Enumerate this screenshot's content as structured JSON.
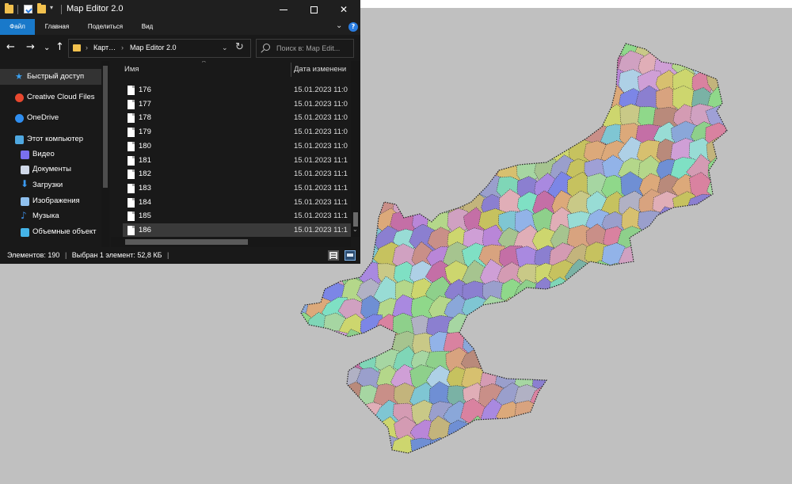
{
  "window": {
    "title": "Map Editor 2.0",
    "minimize_glyph": "—",
    "maximize_glyph": "☐",
    "close_glyph": "✕"
  },
  "ribbon": {
    "tabs": [
      {
        "label": "Файл",
        "active": true
      },
      {
        "label": "Главная",
        "active": false
      },
      {
        "label": "Поделиться",
        "active": false
      },
      {
        "label": "Вид",
        "active": false
      }
    ],
    "collapse_glyph": "⌄",
    "help_glyph": "?"
  },
  "navigation": {
    "back_glyph": "←",
    "forward_glyph": "→",
    "history_glyph": "⌄",
    "up_glyph": "↑",
    "refresh_glyph": "↻"
  },
  "address": {
    "crumbs": [
      {
        "text": "›"
      },
      {
        "text": "Карт…"
      },
      {
        "text": "›"
      },
      {
        "text": "Map Editor 2.0"
      }
    ],
    "dropdown_glyph": "⌄"
  },
  "search": {
    "placeholder": "Поиск в: Map Edit..."
  },
  "nav_pane": {
    "items": [
      {
        "label": "Быстрый доступ",
        "icon": "star-icon",
        "selected": true
      },
      {
        "label": "Creative Cloud Files",
        "icon": "creative-cloud-icon",
        "selected": false
      },
      {
        "label": "OneDrive",
        "icon": "cloud-icon",
        "selected": false
      },
      {
        "label": "Этот компьютер",
        "icon": "computer-icon",
        "selected": false
      },
      {
        "label": "Видео",
        "icon": "video-icon",
        "selected": false
      },
      {
        "label": "Документы",
        "icon": "document-icon",
        "selected": false
      },
      {
        "label": "Загрузки",
        "icon": "download-icon",
        "selected": false
      },
      {
        "label": "Изображения",
        "icon": "image-icon",
        "selected": false
      },
      {
        "label": "Музыка",
        "icon": "music-icon",
        "selected": false
      },
      {
        "label": "Объемные объект",
        "icon": "3d-objects-icon",
        "selected": false
      }
    ]
  },
  "file_list": {
    "columns": {
      "name": "Имя",
      "date": "Дата изменени"
    },
    "rows": [
      {
        "name": "176",
        "date": "15.01.2023 11:0",
        "selected": false
      },
      {
        "name": "177",
        "date": "15.01.2023 11:0",
        "selected": false
      },
      {
        "name": "178",
        "date": "15.01.2023 11:0",
        "selected": false
      },
      {
        "name": "179",
        "date": "15.01.2023 11:0",
        "selected": false
      },
      {
        "name": "180",
        "date": "15.01.2023 11:0",
        "selected": false
      },
      {
        "name": "181",
        "date": "15.01.2023 11:1",
        "selected": false
      },
      {
        "name": "182",
        "date": "15.01.2023 11:1",
        "selected": false
      },
      {
        "name": "183",
        "date": "15.01.2023 11:1",
        "selected": false
      },
      {
        "name": "184",
        "date": "15.01.2023 11:1",
        "selected": false
      },
      {
        "name": "185",
        "date": "15.01.2023 11:1",
        "selected": false
      },
      {
        "name": "186",
        "date": "15.01.2023 11:1",
        "selected": true
      }
    ]
  },
  "status_bar": {
    "item_count": "Элементов: 190",
    "separator": "|",
    "selection": "Выбран 1 элемент: 52,8 КБ",
    "trailing": "|"
  },
  "colors": {
    "canvas_bg": "#c0c0c0",
    "window_bg": "#191919",
    "accent": "#1979ca",
    "region_border": "#222222"
  },
  "map": {
    "region_colors": [
      "#c3b47c",
      "#d49bb3",
      "#7c86e6",
      "#8fd88a",
      "#b986d8",
      "#7fc6d3",
      "#d7c06f",
      "#9fa0d6",
      "#a6c48f",
      "#c98f88",
      "#7fd6b7",
      "#cf9fd6",
      "#8aa7d9",
      "#b4d78a",
      "#d8a37f",
      "#98dcd5",
      "#a989e0",
      "#c9c987",
      "#8ed08b",
      "#d0a1c1",
      "#9a9fcc",
      "#b98a7b",
      "#7fe0c4",
      "#c46fa6",
      "#92b3e8",
      "#cdd66e",
      "#e0aeb7",
      "#6f8fd4",
      "#b1b1c4",
      "#a6d6a2",
      "#c6c25f",
      "#8b7fd0",
      "#dca97a",
      "#7ab2a5",
      "#d982a0",
      "#aed0e6"
    ],
    "outline_glyph": "map-outline"
  }
}
